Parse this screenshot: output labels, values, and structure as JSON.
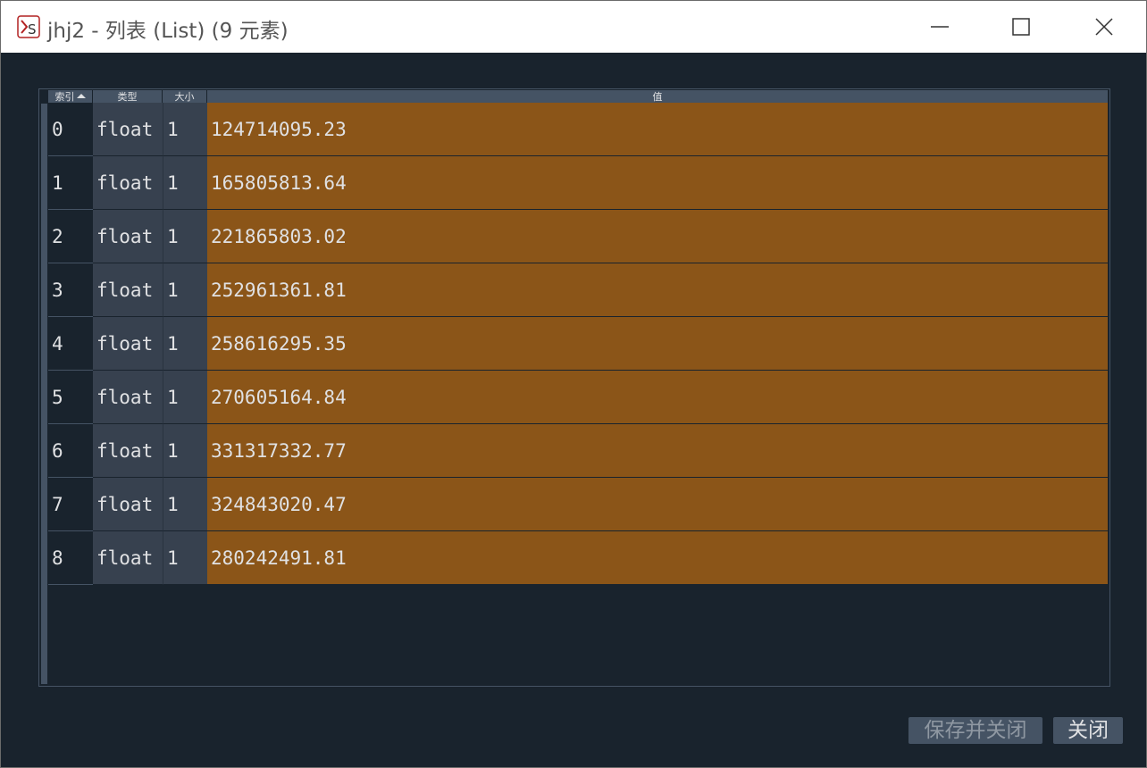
{
  "window": {
    "title": "jhj2 - 列表 (List) (9 元素)",
    "app_icon": "spyder-variable-icon"
  },
  "table": {
    "headers": {
      "index": "索引",
      "type": "类型",
      "size": "大小",
      "value": "值"
    },
    "sort_indicator": "sort-ascending-icon",
    "rows": [
      {
        "index": "0",
        "type": "float",
        "size": "1",
        "value": "124714095.23"
      },
      {
        "index": "1",
        "type": "float",
        "size": "1",
        "value": "165805813.64"
      },
      {
        "index": "2",
        "type": "float",
        "size": "1",
        "value": "221865803.02"
      },
      {
        "index": "3",
        "type": "float",
        "size": "1",
        "value": "252961361.81"
      },
      {
        "index": "4",
        "type": "float",
        "size": "1",
        "value": "258616295.35"
      },
      {
        "index": "5",
        "type": "float",
        "size": "1",
        "value": "270605164.84"
      },
      {
        "index": "6",
        "type": "float",
        "size": "1",
        "value": "331317332.77"
      },
      {
        "index": "7",
        "type": "float",
        "size": "1",
        "value": "324843020.47"
      },
      {
        "index": "8",
        "type": "float",
        "size": "1",
        "value": "280242491.81"
      }
    ]
  },
  "buttons": {
    "save_and_close": "保存并关闭",
    "close": "关闭"
  },
  "colors": {
    "background": "#19232d",
    "header": "#455364",
    "value_cell": "#8b5518",
    "text": "#e0e1e3"
  }
}
